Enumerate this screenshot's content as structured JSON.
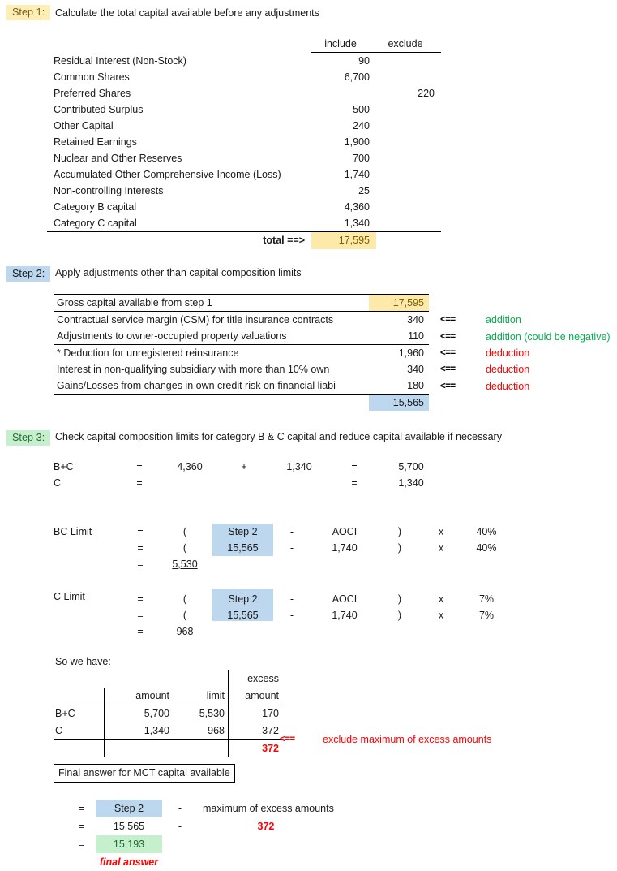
{
  "steps": {
    "step1": {
      "tag": "Step 1:",
      "title": "Calculate the total capital available before any adjustments",
      "headers": {
        "include": "include",
        "exclude": "exclude"
      },
      "rows": [
        {
          "label": "Residual Interest (Non-Stock)",
          "include": "90",
          "exclude": ""
        },
        {
          "label": "Common Shares",
          "include": "6,700",
          "exclude": ""
        },
        {
          "label": "Preferred Shares",
          "include": "",
          "exclude": "220"
        },
        {
          "label": "Contributed Surplus",
          "include": "500",
          "exclude": ""
        },
        {
          "label": "Other Capital",
          "include": "240",
          "exclude": ""
        },
        {
          "label": "Retained Earnings",
          "include": "1,900",
          "exclude": ""
        },
        {
          "label": "Nuclear and Other Reserves",
          "include": "700",
          "exclude": ""
        },
        {
          "label": "Accumulated Other Comprehensive Income (Loss)",
          "include": "1,740",
          "exclude": ""
        },
        {
          "label": "Non-controlling Interests",
          "include": "25",
          "exclude": ""
        },
        {
          "label": "Category B capital",
          "include": "4,360",
          "exclude": ""
        },
        {
          "label": "Category C capital",
          "include": "1,340",
          "exclude": ""
        }
      ],
      "total_label": "total ==>",
      "total_value": "17,595"
    },
    "step2": {
      "tag": "Step 2:",
      "title": "Apply adjustments other than capital composition limits",
      "rows": [
        {
          "label": "Gross capital available from step 1",
          "value": "17,595",
          "arrow": "",
          "note": ""
        },
        {
          "label": "Contractual service margin (CSM) for title insurance contracts",
          "value": "340",
          "arrow": "<==",
          "note": "addition"
        },
        {
          "label": "Adjustments to owner-occupied property valuations",
          "value": "110",
          "arrow": "<==",
          "note": "addition (could be negative)"
        },
        {
          "label": "* Deduction for unregistered reinsurance",
          "value": "1,960",
          "arrow": "<==",
          "note": "deduction"
        },
        {
          "label": "Interest in non-qualifying subsidiary with more than 10% own",
          "value": "340",
          "arrow": "<==",
          "note": "deduction"
        },
        {
          "label": "Gains/Losses from changes in own credit risk on financial liabi",
          "value": "180",
          "arrow": "<==",
          "note": "deduction"
        }
      ],
      "subtotal": "15,565"
    },
    "step3": {
      "tag": "Step 3:",
      "title": "Check capital composition limits for category B & C capital and reduce capital available if necessary",
      "bc_rows": [
        {
          "label": "B+C",
          "eq": "=",
          "v1": "4,360",
          "op": "+",
          "v2": "1,340",
          "eq2": "=",
          "v3": "5,700"
        },
        {
          "label": "C",
          "eq": "=",
          "v1": "",
          "op": "",
          "v2": "",
          "eq2": "=",
          "v3": "1,340"
        }
      ],
      "bc_limit": {
        "label": "BC Limit",
        "row1": {
          "eq": "=",
          "paren": "(",
          "step": "Step 2",
          "minus": "-",
          "aoci": "AOCI",
          "paren2": ")",
          "x": "x",
          "pct": "40%"
        },
        "row2": {
          "eq": "=",
          "paren": "(",
          "step": "15,565",
          "minus": "-",
          "aoci": "1,740",
          "paren2": ")",
          "x": "x",
          "pct": "40%"
        },
        "row3": {
          "eq": "=",
          "result": "5,530"
        }
      },
      "c_limit": {
        "label": "C Limit",
        "row1": {
          "eq": "=",
          "paren": "(",
          "step": "Step 2",
          "minus": "-",
          "aoci": "AOCI",
          "paren2": ")",
          "x": "x",
          "pct": "7%"
        },
        "row2": {
          "eq": "=",
          "paren": "(",
          "step": "15,565",
          "minus": "-",
          "aoci": "1,740",
          "paren2": ")",
          "x": "x",
          "pct": "7%"
        },
        "row3": {
          "eq": "=",
          "result": "968"
        }
      }
    },
    "summary": {
      "intro": "So we have:",
      "header_excess": "excess",
      "headers": {
        "blank": "",
        "amount": "amount",
        "limit": "limit",
        "excess_amount": "amount"
      },
      "rows": [
        {
          "label": "B+C",
          "amount": "5,700",
          "limit": "5,530",
          "excess": "170"
        },
        {
          "label": "C",
          "amount": "1,340",
          "limit": "968",
          "excess": "372"
        }
      ],
      "max_excess": "372",
      "max_arrow": "<==",
      "max_note": "exclude maximum of excess amounts"
    },
    "final": {
      "box_title": "Final answer for MCT capital available",
      "rows": [
        {
          "eq": "=",
          "val": "Step 2",
          "minus": "-",
          "text": "maximum of excess amounts"
        },
        {
          "eq": "=",
          "val": "15,565",
          "minus": "-",
          "text": "372"
        },
        {
          "eq": "=",
          "val": "15,193",
          "minus": "",
          "text": ""
        }
      ],
      "caption": "final answer"
    }
  },
  "colors": {
    "yellow_fill": "#fde9a9",
    "blue_fill": "#bdd7ee",
    "green_fill": "#c6efce",
    "addition_green": "#00b050",
    "deduction_red": "#ff0000"
  }
}
